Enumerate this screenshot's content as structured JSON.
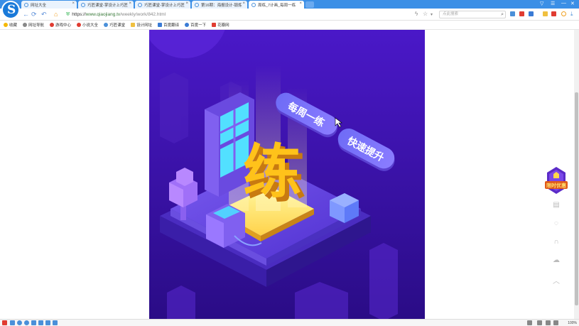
{
  "browser": {
    "logo_letter": "S",
    "tabs": [
      {
        "label": "网址大全",
        "active": false
      },
      {
        "label": "巧匠课堂-掌设计上巧匠",
        "active": false
      },
      {
        "label": "巧匠课堂-掌设计上巧匠",
        "active": false
      },
      {
        "label": "第16期：海报设计-锻炼",
        "active": false
      },
      {
        "label": "周练_7计画_每周一练",
        "active": true
      }
    ],
    "tab_close": "×",
    "window_controls": [
      "▽",
      "☰",
      "—",
      "❐",
      "✕"
    ],
    "nav": {
      "back": "←",
      "forward": "→",
      "refresh": "⟳",
      "undo": "↶",
      "home": "⌂"
    },
    "url": {
      "scheme": "https://",
      "host": "www.qiaojiang.tv",
      "path": "/weekly/work/842.html"
    },
    "search_placeholder": "点此搜索",
    "bookmarks": [
      {
        "label": "收藏",
        "color": "#f5b800"
      },
      {
        "label": "网址导航",
        "color": "#888888"
      },
      {
        "label": "游戏中心",
        "color": "#e03c31"
      },
      {
        "label": "小说大全",
        "color": "#e03c31"
      },
      {
        "label": "巧匠课堂",
        "color": "#4a90d9"
      },
      {
        "label": "设计网址",
        "color": "#f0c040"
      },
      {
        "label": "百度翻译",
        "color": "#3a7bd5"
      },
      {
        "label": "百度一下",
        "color": "#3a7bd5"
      },
      {
        "label": "花瓣网",
        "color": "#e03c31"
      }
    ],
    "zoom_level": "100%"
  },
  "artwork": {
    "pill_1": "每周一练",
    "pill_2": "快速提升",
    "big_char": "练"
  },
  "side_panel": {
    "badge_label": "限时优惠"
  },
  "colors": {
    "tab_strip": "#3b8fe6",
    "art_bg": "#3a12a8",
    "accent_yellow": "#ffc21a"
  }
}
